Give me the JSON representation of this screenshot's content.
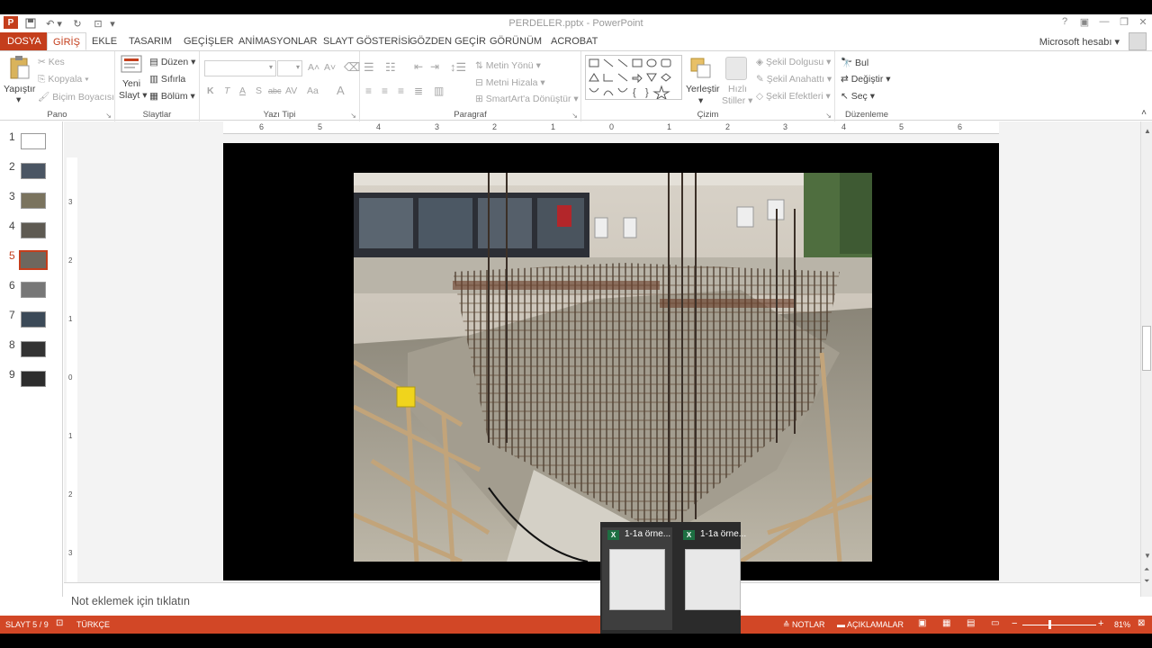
{
  "window": {
    "title": "PERDELER.pptx - PowerPoint"
  },
  "colors": {
    "accent": "#c43e1c",
    "status_bar": "#d24726",
    "excel_green": "#1d6f42"
  },
  "tabs": [
    "DOSYA",
    "GİRİŞ",
    "EKLE",
    "TASARIM",
    "GEÇİŞLER",
    "ANİMASYONLAR",
    "SLAYT GÖSTERİSİ",
    "GÖZDEN GEÇİR",
    "GÖRÜNÜM",
    "ACROBAT"
  ],
  "account": {
    "label": "Microsoft hesabı"
  },
  "ribbon": {
    "pano": {
      "label": "Pano",
      "paste": "Yapıştır",
      "cut": "Kes",
      "copy": "Kopyala",
      "format_painter": "Biçim Boyacısı"
    },
    "slaytlar": {
      "label": "Slaytlar",
      "new_line1": "Yeni",
      "new_line2": "Slayt",
      "layout": "Düzen",
      "reset": "Sıfırla",
      "section": "Bölüm"
    },
    "yazi": {
      "label": "Yazı Tipi",
      "bold": "K",
      "italic": "T",
      "underline": "A",
      "shadow": "S",
      "strike": "abc",
      "spacing": "AV",
      "case": "Aa",
      "color": "A"
    },
    "paragraf": {
      "label": "Paragraf",
      "text_dir": "Metin Yönü",
      "align_text": "Metni Hizala",
      "smartart": "SmartArt'a Dönüştür"
    },
    "cizim": {
      "label": "Çizim",
      "arrange": "Yerleştir",
      "quick_styles_1": "Hızlı",
      "quick_styles_2": "Stiller",
      "fill": "Şekil Dolgusu",
      "outline": "Şekil Anahattı",
      "effects": "Şekil Efektleri"
    },
    "duzenleme": {
      "label": "Düzenleme",
      "find": "Bul",
      "replace": "Değiştir",
      "select": "Seç"
    }
  },
  "slides": [
    {
      "num": "1"
    },
    {
      "num": "2"
    },
    {
      "num": "3"
    },
    {
      "num": "4"
    },
    {
      "num": "5"
    },
    {
      "num": "6"
    },
    {
      "num": "7"
    },
    {
      "num": "8"
    },
    {
      "num": "9"
    }
  ],
  "selected_slide": "5",
  "ruler": {
    "h": [
      "6",
      "5",
      "4",
      "3",
      "2",
      "1",
      "0",
      "1",
      "2",
      "3",
      "4",
      "5",
      "6"
    ],
    "v": [
      "3",
      "2",
      "1",
      "0",
      "1",
      "2",
      "3"
    ]
  },
  "notes": {
    "placeholder": "Not eklemek için tıklatın"
  },
  "status": {
    "slide": "SLAYT 5 / 9",
    "language": "TÜRKÇE",
    "notes": "NOTLAR",
    "comments": "AÇIKLAMALAR",
    "zoom": "81%"
  },
  "taskbar_popup": [
    {
      "title": "1-1a örne..."
    },
    {
      "title": "1-1a örne..."
    }
  ]
}
